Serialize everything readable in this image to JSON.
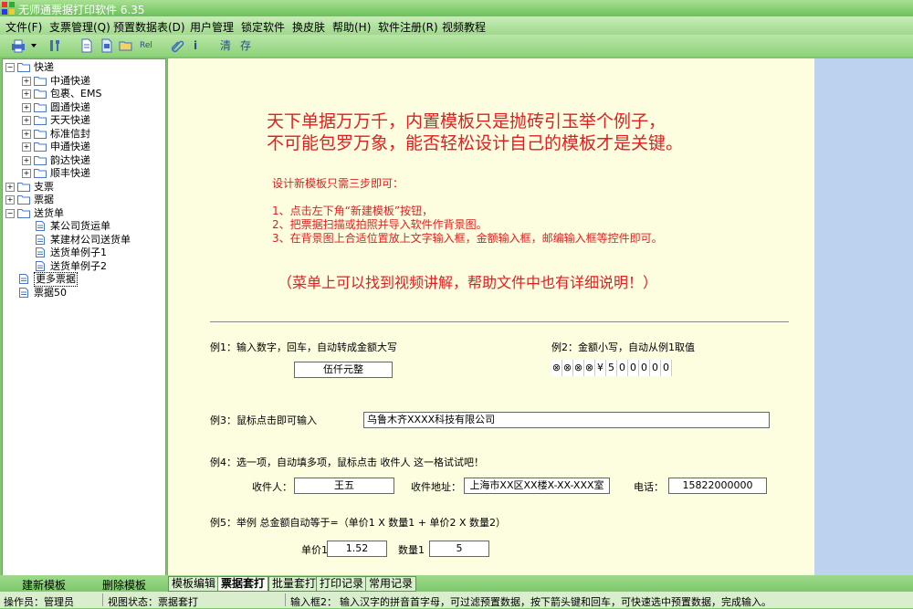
{
  "window": {
    "title": "无师通票据打印软件 6.35"
  },
  "menu": [
    "文件(F)",
    "支票管理(Q)",
    "预置数据表(D)",
    "用户管理",
    "锁定软件",
    "换皮肤",
    "帮助(H)",
    "软件注册(R)",
    "视频教程"
  ],
  "toolbar": {
    "rel": "Rel",
    "clear": "清",
    "save": "存",
    "info": "i"
  },
  "tree": [
    {
      "label": "快递",
      "level": 0,
      "type": "folder",
      "exp": "−"
    },
    {
      "label": "中通快递",
      "level": 1,
      "type": "folder",
      "exp": "+"
    },
    {
      "label": "包裹、EMS",
      "level": 1,
      "type": "folder",
      "exp": "+"
    },
    {
      "label": "圆通快递",
      "level": 1,
      "type": "folder",
      "exp": "+"
    },
    {
      "label": "天天快递",
      "level": 1,
      "type": "folder",
      "exp": "+"
    },
    {
      "label": "标准信封",
      "level": 1,
      "type": "folder",
      "exp": "+"
    },
    {
      "label": "申通快递",
      "level": 1,
      "type": "folder",
      "exp": "+"
    },
    {
      "label": "韵达快递",
      "level": 1,
      "type": "folder",
      "exp": "+"
    },
    {
      "label": "顺丰快递",
      "level": 1,
      "type": "folder",
      "exp": "+"
    },
    {
      "label": "支票",
      "level": 0,
      "type": "folder",
      "exp": "+"
    },
    {
      "label": "票据",
      "level": 0,
      "type": "folder",
      "exp": "+"
    },
    {
      "label": "送货单",
      "level": 0,
      "type": "folder",
      "exp": "−"
    },
    {
      "label": "某公司货运单",
      "level": 1,
      "type": "doc",
      "exp": ""
    },
    {
      "label": "某建材公司送货单",
      "level": 1,
      "type": "doc",
      "exp": ""
    },
    {
      "label": "送货单例子1",
      "level": 1,
      "type": "doc",
      "exp": ""
    },
    {
      "label": "送货单例子2",
      "level": 1,
      "type": "doc",
      "exp": ""
    },
    {
      "label": "更多票据",
      "level": 0,
      "type": "doc",
      "exp": "",
      "selected": true
    },
    {
      "label": "票据50",
      "level": 0,
      "type": "doc",
      "exp": ""
    }
  ],
  "main": {
    "headline1": "天下单据万万千，内置模板只是抛砖引玉举个例子，",
    "headline2": "不可能包罗万象，能否轻松设计自己的模板才是关键。",
    "steps_title": "设计新模板只需三步即可：",
    "step1": "1、点击左下角“新建模板”按钮，",
    "step2": "2、把票据扫描或拍照并导入软件作背景图。",
    "step3": "3、在背景图上合适位置放上文字输入框，金额输入框，邮编输入框等控件即可。",
    "note": "（菜单上可以找到视频讲解，帮助文件中也有详细说明！）",
    "ex1_label": "例1：输入数字，回车，自动转成金额大写",
    "ex1_value": "伍仟元整",
    "ex2_label": "例2：金额小写，自动从例1取值",
    "ex2_digits": [
      "⊗",
      "⊗",
      "⊗",
      "⊗",
      "¥",
      "5",
      "0",
      "0",
      "0",
      "0",
      "0"
    ],
    "ex3_label": "例3：鼠标点击即可输入",
    "ex3_value": "乌鲁木齐XXXX科技有限公司",
    "ex4_label": "例4：选一项，自动填多项，鼠标点击 收件人 这一格试试吧！",
    "receiver_label": "收件人：",
    "receiver_value": "王五",
    "address_label": "收件地址：",
    "address_value": "上海市XX区XX楼X-XX-XXX室",
    "phone_label": "电话：",
    "phone_value": "15822000000",
    "ex5_label": "例5：举例 总金额自动等于=（单价1 X 数量1 + 单价2 X 数量2）",
    "price1_label": "单价1",
    "price1_value": "1.52",
    "qty1_label": "数量1",
    "qty1_value": "5"
  },
  "bottom": {
    "new_template": "建新模板",
    "delete_template": "删除模板",
    "tabs": [
      "模板编辑",
      "票据套打",
      "批量套打",
      "打印记录",
      "常用记录"
    ]
  },
  "status": {
    "operator": "操作员：管理员",
    "view_state": "视图状态：票据套打",
    "input_box": "输入框2：",
    "hint": "输入汉字的拼音首字母，可过滤预置数据，按下箭头键和回车，可快速选中预置数据，完成输入。"
  },
  "colors": {
    "accent_red": "#e02020",
    "skin_green": "#7cc86a",
    "paper": "#fdfde0"
  }
}
